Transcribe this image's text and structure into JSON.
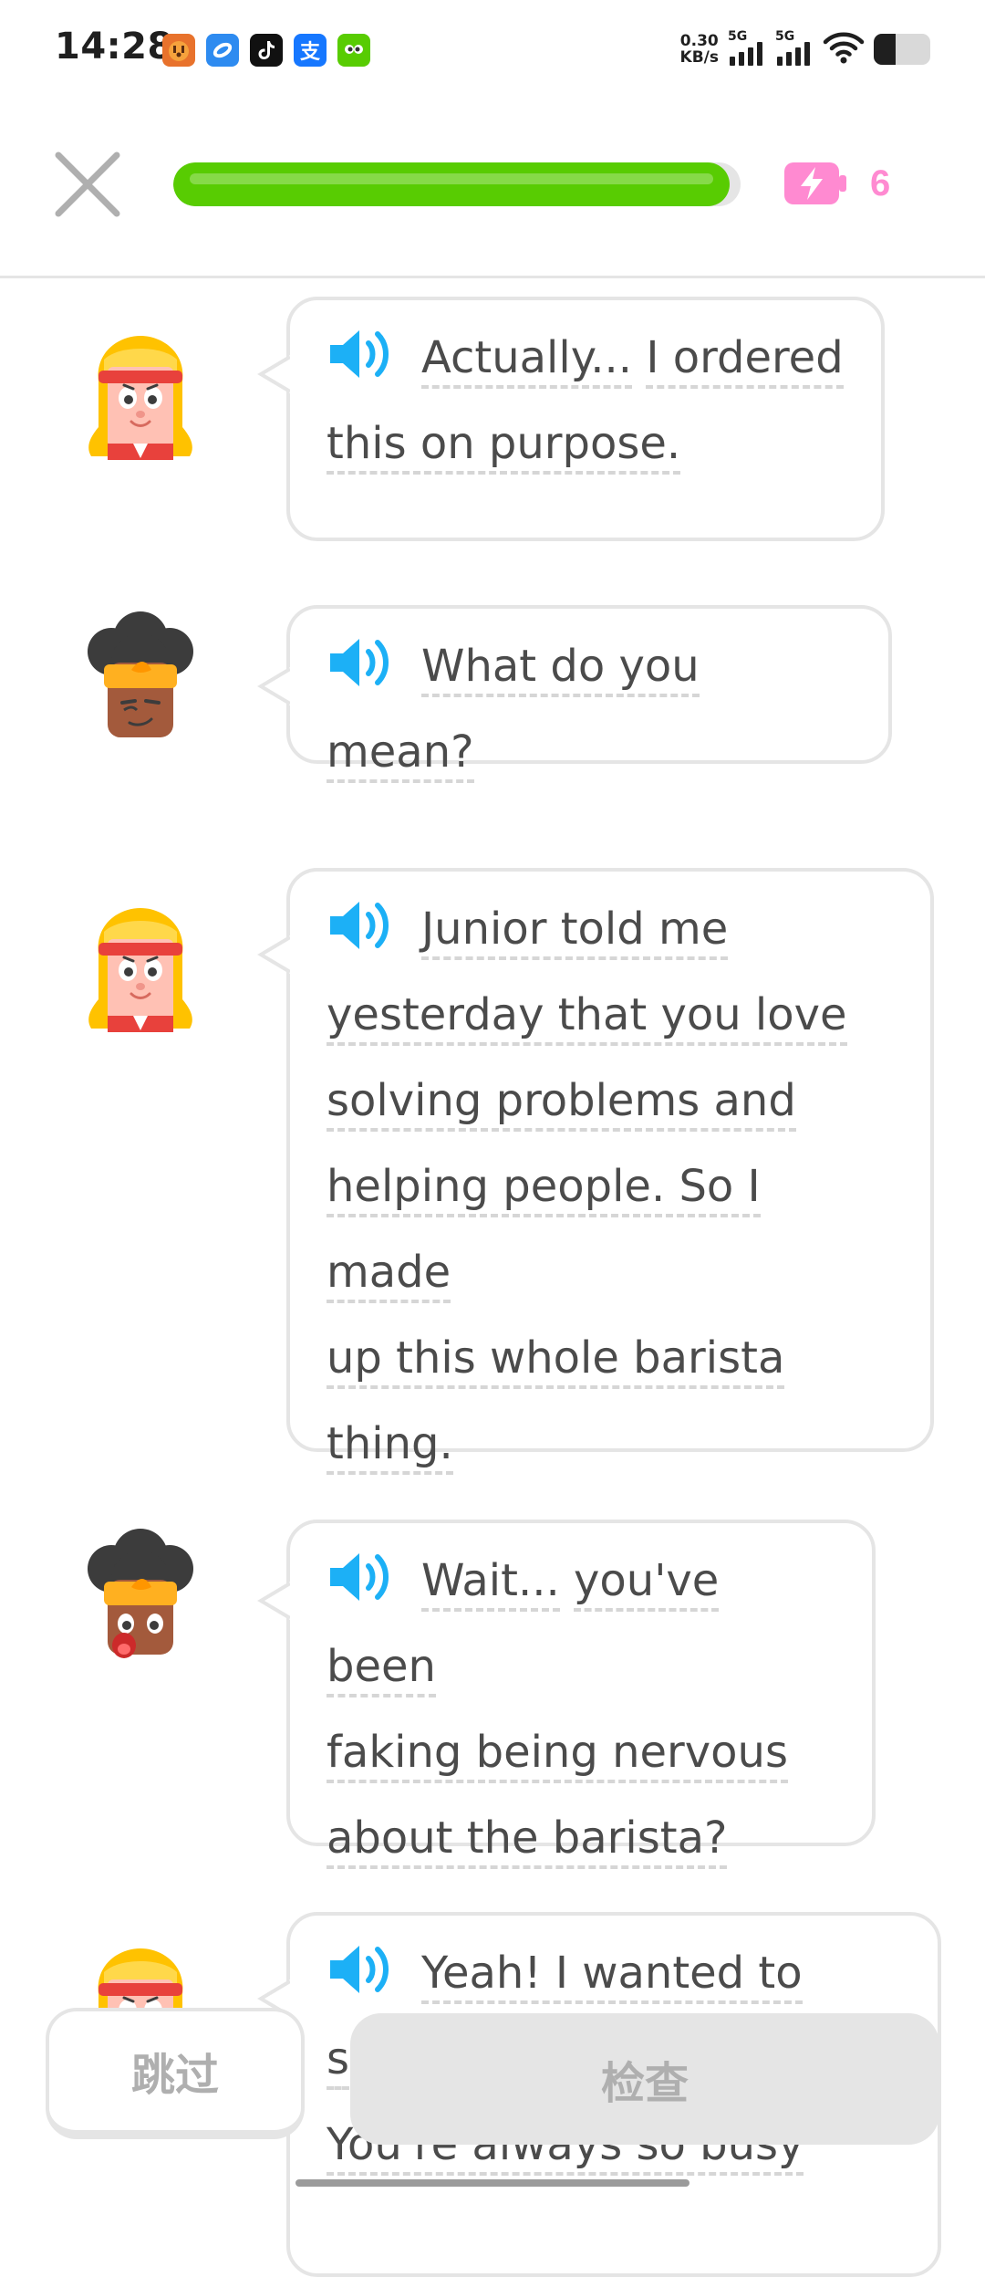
{
  "status_bar": {
    "time": "14:28",
    "app_icons": [
      "tiger-app-icon",
      "blue-app-icon",
      "tiktok-icon",
      "alipay-icon",
      "duolingo-icon"
    ],
    "net_speed_value": "0.30",
    "net_speed_unit": "KB/s",
    "signal_1_label": "5G",
    "signal_2_label": "5G",
    "battery_level": 0.38
  },
  "header": {
    "progress": 0.98,
    "energy_count": "6",
    "colors": {
      "progress": "#58cc02",
      "energy": "#ff8ad1"
    }
  },
  "messages": [
    {
      "speaker": "lily",
      "words": [
        "Actually...",
        "I ordered",
        "this on purpose."
      ]
    },
    {
      "speaker": "bea",
      "words": [
        "What do you mean?"
      ]
    },
    {
      "speaker": "lily",
      "words": [
        "Junior told me",
        "yesterday that you love",
        "solving problems and",
        "helping people. So I made",
        "up this whole barista",
        "thing."
      ]
    },
    {
      "speaker": "bea",
      "words": [
        "Wait...",
        "you've been",
        "faking being nervous",
        "about the barista?"
      ]
    },
    {
      "speaker": "lily",
      "words": [
        "Yeah! I wanted to",
        "s",
        "You're always so busy"
      ]
    }
  ],
  "buttons": {
    "skip_label": "跳过",
    "check_label": "检查"
  }
}
